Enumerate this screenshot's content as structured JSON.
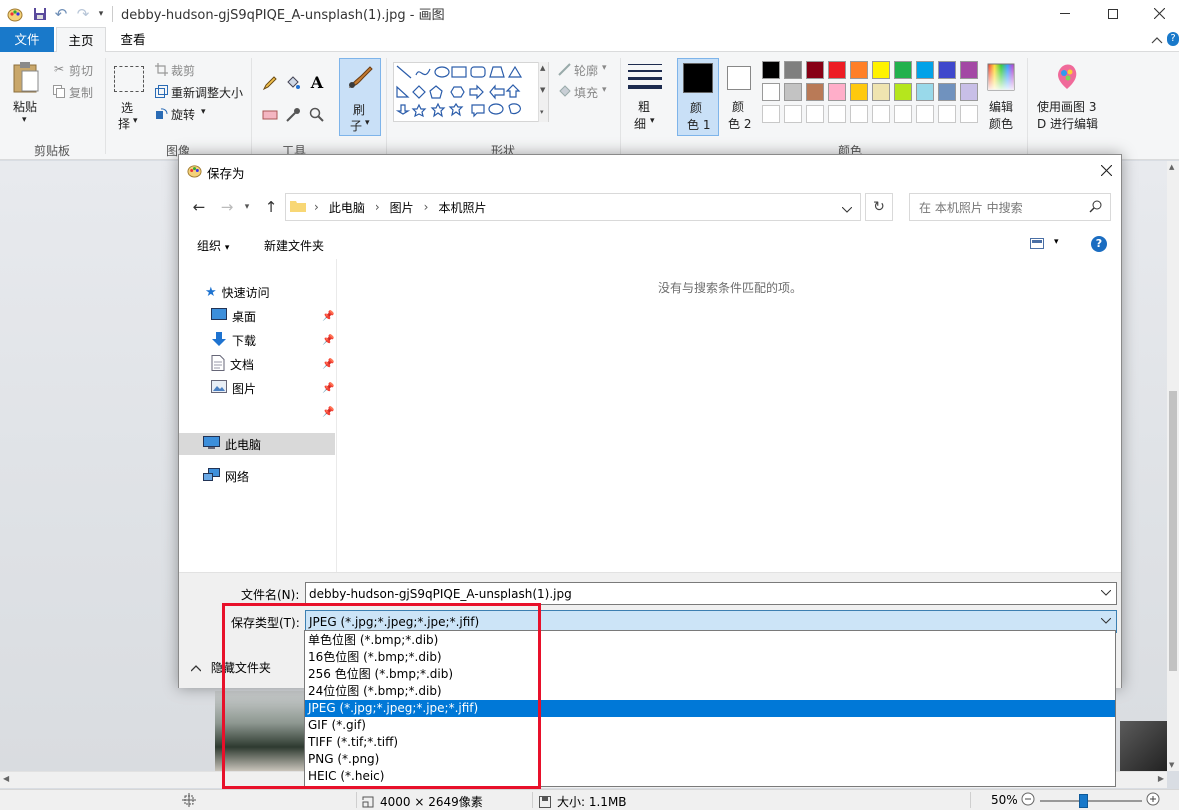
{
  "window": {
    "title": "debby-hudson-gjS9qPIQE_A-unsplash(1).jpg - 画图"
  },
  "ribbon": {
    "tabs": [
      "文件",
      "主页",
      "查看"
    ],
    "clipboard": {
      "paste": "粘贴",
      "cut": "剪切",
      "copy": "复制",
      "group": "剪贴板"
    },
    "image": {
      "select_1": "选",
      "select_2": "择",
      "crop": "裁剪",
      "resize": "重新调整大小",
      "rotate": "旋转",
      "group": "图像"
    },
    "tools": {
      "group": "工具"
    },
    "brushes": {
      "label_1": "刷",
      "label_2": "子"
    },
    "shapes": {
      "outline": "轮廓",
      "fill": "填充",
      "group": "形状"
    },
    "size": {
      "label_1": "粗",
      "label_2": "细"
    },
    "color1": {
      "label_1": "颜",
      "label_2": "色 1",
      "value": "#000000"
    },
    "color2": {
      "label_1": "颜",
      "label_2": "色 2",
      "value": "#ffffff"
    },
    "colors_group": "颜色",
    "palette_row1": [
      "#000000",
      "#7f7f7f",
      "#880015",
      "#ed1c24",
      "#ff7f27",
      "#fff200",
      "#22b14c",
      "#00a2e8",
      "#3f48cc",
      "#a349a4"
    ],
    "palette_row2": [
      "#ffffff",
      "#c3c3c3",
      "#b97a57",
      "#ffaec9",
      "#ffc90e",
      "#efe4b0",
      "#b5e61d",
      "#99d9ea",
      "#7092be",
      "#c8bfe7"
    ],
    "edit_colors_1": "编辑",
    "edit_colors_2": "颜色",
    "paint3d_1": "使用画图 3",
    "paint3d_2": "D 进行编辑"
  },
  "status": {
    "dimensions": "4000 × 2649像素",
    "size": "大小: 1.1MB",
    "zoom": "50%",
    "zoom_level": 0.5
  },
  "dialog": {
    "title": "保存为",
    "path": [
      "此电脑",
      "图片",
      "本机照片"
    ],
    "search_placeholder": "在 本机照片 中搜索",
    "organize": "组织",
    "new_folder": "新建文件夹",
    "nav": {
      "quick_access": "快速访问",
      "desktop": "桌面",
      "downloads": "下载",
      "documents": "文档",
      "pictures": "图片",
      "this_pc": "此电脑",
      "network": "网络"
    },
    "empty_message": "没有与搜索条件匹配的项。",
    "filename_label": "文件名(N):",
    "filename_value": "debby-hudson-gjS9qPIQE_A-unsplash(1).jpg",
    "filetype_label": "保存类型(T):",
    "filetype_value": "JPEG (*.jpg;*.jpeg;*.jpe;*.jfif)",
    "hide_folders": "隐藏文件夹",
    "filetype_options": [
      "单色位图 (*.bmp;*.dib)",
      "16色位图 (*.bmp;*.dib)",
      "256 色位图 (*.bmp;*.dib)",
      "24位位图 (*.bmp;*.dib)",
      "JPEG (*.jpg;*.jpeg;*.jpe;*.jfif)",
      "GIF (*.gif)",
      "TIFF (*.tif;*.tiff)",
      "PNG (*.png)",
      "HEIC (*.heic)"
    ],
    "selected_option_index": 4
  },
  "colors": {
    "accent": "#0078d7",
    "file_tab": "#1979ca",
    "annotation": "#e8102a"
  }
}
